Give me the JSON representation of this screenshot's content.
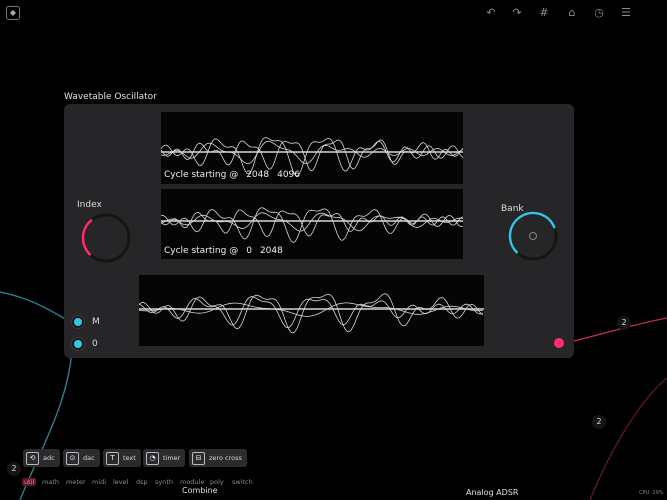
{
  "toolbar": {
    "logo_icon": "logo-icon",
    "icons": [
      "undo-icon",
      "redo-icon",
      "grid-icon",
      "lock-icon",
      "clock-icon",
      "menu-icon"
    ]
  },
  "module": {
    "title": "Wavetable Oscillator",
    "scope1": {
      "label": "Cycle starting @",
      "start": "2048",
      "end": "4096"
    },
    "scope2": {
      "label": "Cycle starting @",
      "start": "0",
      "end": "2048"
    },
    "index_label": "Index",
    "bank_label": "Bank",
    "index_level": 0.35,
    "bank_level": 0.75,
    "inputs": [
      {
        "label": "M"
      },
      {
        "label": "0"
      }
    ],
    "accent_blue": "#35c6e6",
    "accent_pink": "#ff2d6f"
  },
  "badges": [
    "2",
    "2",
    "2"
  ],
  "palette": {
    "buttons": [
      {
        "label": "adc",
        "icon": "adc-icon"
      },
      {
        "label": "dac",
        "icon": "dac-icon"
      },
      {
        "label": "text",
        "icon": "text-icon"
      },
      {
        "label": "timer",
        "icon": "timer-icon"
      },
      {
        "label": "zero cross",
        "icon": "zero-cross-icon"
      }
    ],
    "categories": [
      "util",
      "math",
      "meter",
      "midi",
      "level",
      "dsp",
      "synth",
      "module",
      "poly",
      "switch"
    ]
  },
  "bottom": {
    "combine_label": "Combine",
    "adsr_label": "Analog ADSR",
    "cpu": "CPU: 29%"
  }
}
